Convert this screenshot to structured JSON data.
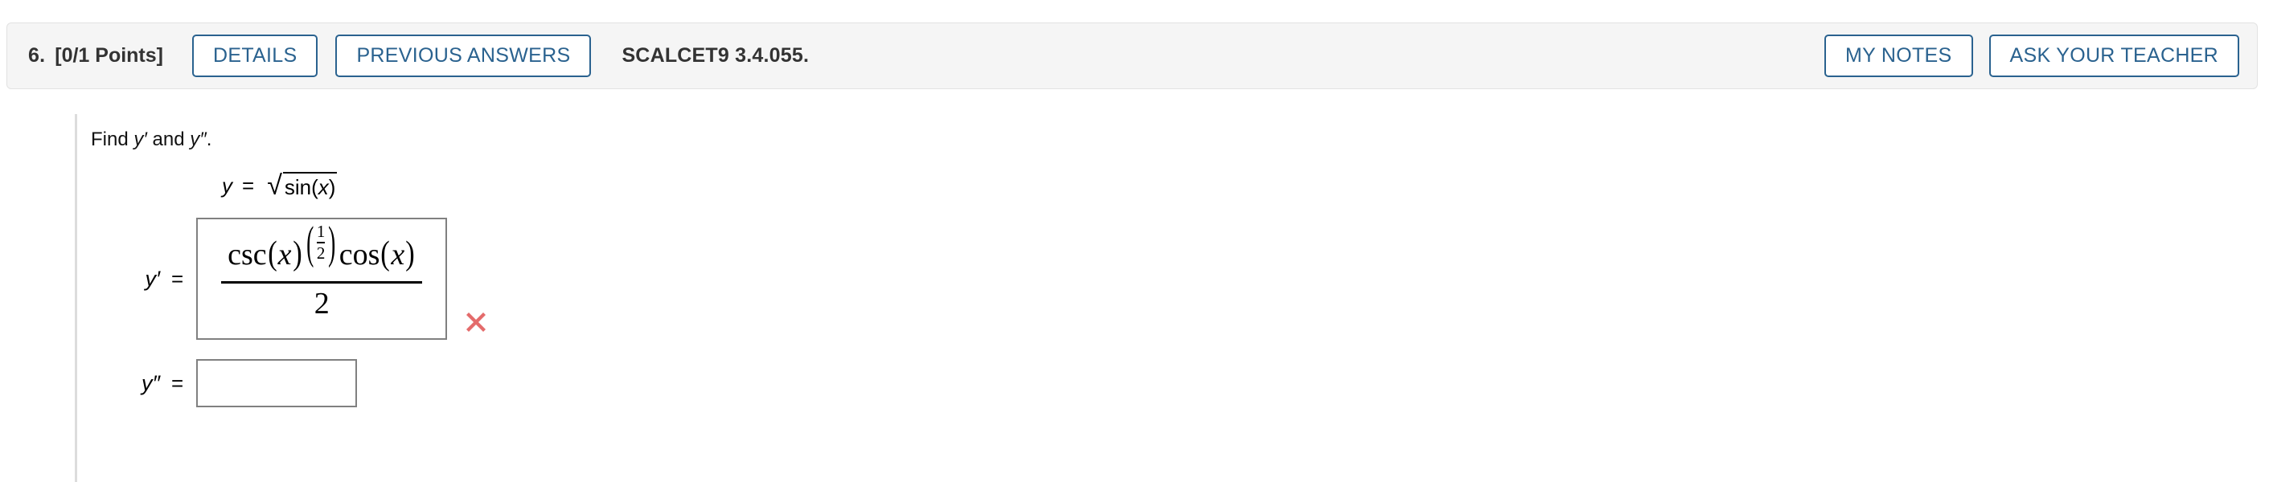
{
  "header": {
    "question_number": "6.",
    "points": "[0/1 Points]",
    "details_label": "DETAILS",
    "previous_answers_label": "PREVIOUS ANSWERS",
    "textbook_code": "SCALCET9 3.4.055.",
    "my_notes_label": "MY NOTES",
    "ask_your_teacher_label": "ASK YOUR TEACHER",
    "accent_color": "#2a628f",
    "bar_background": "#f5f5f5"
  },
  "question": {
    "prompt_prefix": "Find ",
    "prompt_first_derivative": "y′",
    "prompt_middle": " and ",
    "prompt_second_derivative": "y″",
    "prompt_suffix": ".",
    "given": {
      "lhs": "y",
      "equals": "=",
      "radicand": "sin(x)"
    },
    "answers": [
      {
        "label": "y′",
        "equals": "=",
        "value_latex": "csc(x)^(1/2) cos(x) / 2",
        "numerator_fn1": "csc",
        "numerator_var1": "x",
        "exponent_numerator": "1",
        "exponent_denominator": "2",
        "numerator_fn2": "cos",
        "numerator_var2": "x",
        "denominator": "2",
        "status": "incorrect",
        "status_icon": "x-mark-icon",
        "status_color": "#e46b6b"
      },
      {
        "label": "y″",
        "equals": "=",
        "value_latex": "",
        "placeholder": "",
        "status": "empty"
      }
    ]
  }
}
